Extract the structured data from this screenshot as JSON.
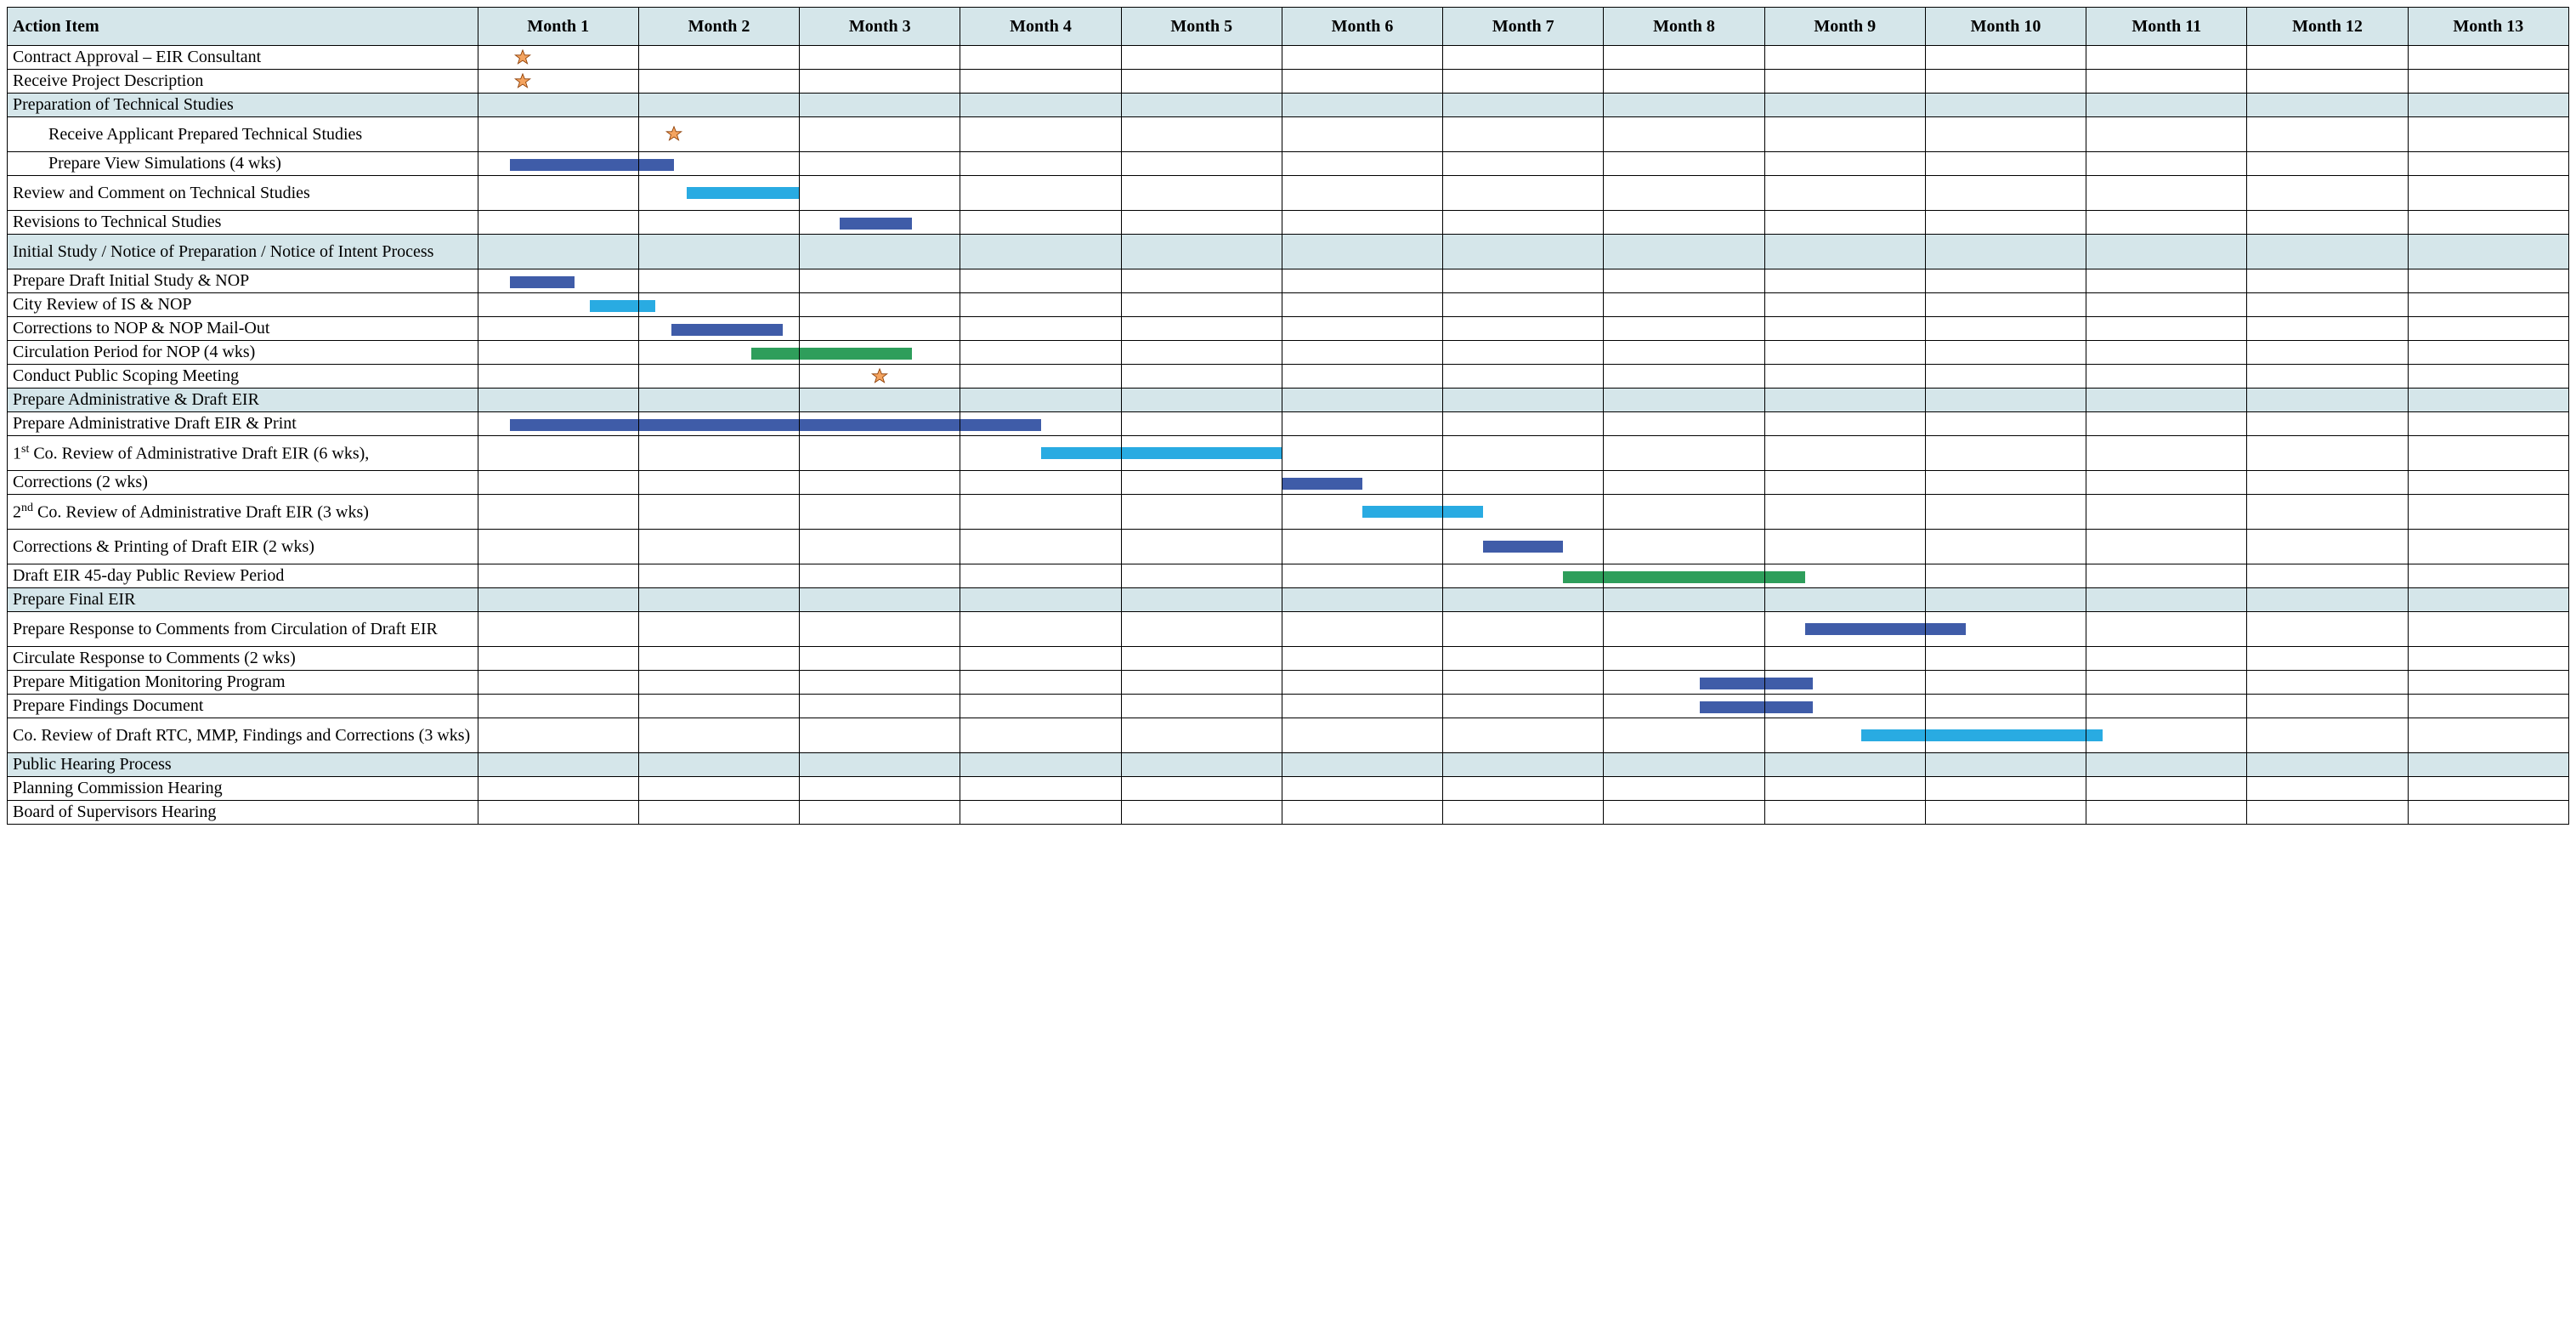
{
  "chart_data": {
    "type": "gantt",
    "months": 13,
    "columns_header": "Action Item",
    "month_label_prefix": "Month ",
    "rows": [
      {
        "label": "Contract Approval – EIR Consultant",
        "type": "task",
        "star": {
          "month": 1,
          "pos": 0.28
        }
      },
      {
        "label": "Receive Project Description",
        "type": "task",
        "star": {
          "month": 1,
          "pos": 0.28
        }
      },
      {
        "label": "Preparation of Technical Studies",
        "type": "section"
      },
      {
        "label": "Receive Applicant Prepared Technical Studies",
        "type": "task",
        "indent": 1,
        "two_line": true,
        "star": {
          "month": 2,
          "pos": 0.22
        }
      },
      {
        "label": "Prepare View Simulations (4 wks)",
        "type": "task",
        "indent": 1,
        "bar": {
          "start": 0.2,
          "end": 1.22,
          "color": "navy"
        }
      },
      {
        "label": "Review and Comment on Technical Studies",
        "type": "task",
        "two_line": true,
        "bar": {
          "start": 1.3,
          "end": 2.0,
          "color": "cyan"
        }
      },
      {
        "label": "Revisions to Technical Studies",
        "type": "task",
        "bar": {
          "start": 2.25,
          "end": 2.7,
          "color": "navy"
        }
      },
      {
        "label": "Initial Study / Notice of Preparation / Notice of Intent Process",
        "type": "section",
        "two_line": true
      },
      {
        "label": "Prepare Draft Initial Study & NOP",
        "type": "task",
        "bar": {
          "start": 0.2,
          "end": 0.6,
          "color": "navy"
        }
      },
      {
        "label": "City Review of IS & NOP",
        "type": "task",
        "bar": {
          "start": 0.7,
          "end": 1.1,
          "color": "cyan"
        }
      },
      {
        "label": "Corrections to NOP & NOP Mail-Out",
        "type": "task",
        "bar": {
          "start": 1.2,
          "end": 1.9,
          "color": "navy"
        }
      },
      {
        "label": "Circulation Period for NOP  (4 wks)",
        "type": "task",
        "bar": {
          "start": 1.7,
          "end": 2.7,
          "color": "green"
        }
      },
      {
        "label": "Conduct Public Scoping Meeting",
        "type": "task",
        "star": {
          "month": 3,
          "pos": 0.5
        }
      },
      {
        "label": "Prepare Administrative & Draft EIR",
        "type": "section"
      },
      {
        "label": "Prepare Administrative Draft EIR & Print",
        "type": "task",
        "bar": {
          "start": 0.2,
          "end": 3.5,
          "color": "navy"
        }
      },
      {
        "label_html": "1<sup>st</sup> Co. Review of Administrative Draft EIR (6 wks),",
        "type": "task",
        "two_line": true,
        "bar": {
          "start": 3.5,
          "end": 5.0,
          "color": "cyan"
        }
      },
      {
        "label": "Corrections (2 wks)",
        "type": "task",
        "bar": {
          "start": 5.0,
          "end": 5.5,
          "color": "navy"
        }
      },
      {
        "label_html": "2<sup>nd</sup> Co. Review of Administrative Draft EIR (3 wks)",
        "type": "task",
        "two_line": true,
        "bar": {
          "start": 5.5,
          "end": 6.25,
          "color": "cyan"
        }
      },
      {
        "label": "Corrections & Printing of Draft EIR (2 wks)",
        "type": "task",
        "two_line": true,
        "bar": {
          "start": 6.25,
          "end": 6.75,
          "color": "navy"
        }
      },
      {
        "label": "Draft EIR 45-day Public Review Period",
        "type": "task",
        "bar": {
          "start": 6.75,
          "end": 8.25,
          "color": "green"
        }
      },
      {
        "label": "Prepare Final EIR",
        "type": "section"
      },
      {
        "label": "Prepare Response to Comments from Circulation of Draft EIR",
        "type": "task",
        "two_line": true,
        "bar": {
          "start": 8.25,
          "end": 9.25,
          "color": "navy"
        }
      },
      {
        "label": "Circulate Response to Comments (2 wks)",
        "type": "task"
      },
      {
        "label": "Prepare Mitigation Monitoring Program",
        "type": "task",
        "bar": {
          "start": 7.6,
          "end": 8.3,
          "color": "navy"
        }
      },
      {
        "label": "Prepare Findings Document",
        "type": "task",
        "bar": {
          "start": 7.6,
          "end": 8.3,
          "color": "navy"
        }
      },
      {
        "label": "Co. Review of Draft RTC, MMP, Findings and Corrections (3 wks)",
        "type": "task",
        "two_line": true,
        "bar": {
          "start": 8.6,
          "end": 10.1,
          "color": "cyan"
        }
      },
      {
        "label": "Public Hearing Process",
        "type": "section"
      },
      {
        "label": "Planning Commission Hearing",
        "type": "task"
      },
      {
        "label": "Board of Supervisors Hearing",
        "type": "task"
      }
    ]
  }
}
